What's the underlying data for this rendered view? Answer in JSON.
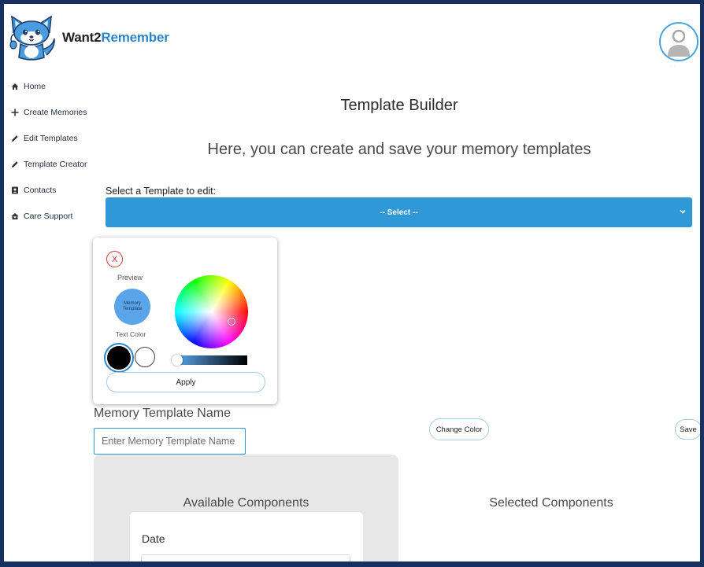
{
  "app": {
    "brand_part1": "Want2",
    "brand_part2": "Remember",
    "avatar_caption": "·· ·"
  },
  "sidebar": {
    "items": [
      {
        "label": "Home",
        "icon": "home-icon"
      },
      {
        "label": "Create Memories",
        "icon": "plus-icon"
      },
      {
        "label": "Edit Templates",
        "icon": "pencil-icon"
      },
      {
        "label": "Template Creator",
        "icon": "pencil-icon"
      },
      {
        "label": "Contacts",
        "icon": "contact-card-icon"
      },
      {
        "label": "Care Support",
        "icon": "home-heart-icon"
      }
    ]
  },
  "main": {
    "title": "Template Builder",
    "subtitle": "Here, you can create and save your memory templates",
    "select_label": "Select a Template to edit:",
    "select_value": "-- Select --",
    "name_label": "Memory Template Name",
    "name_placeholder": "Enter Memory Template Name",
    "change_color_label": "Change Color",
    "save_label": "Save",
    "available_title": "Available Components",
    "selected_title": "Selected Components",
    "components": [
      {
        "name": "Date"
      }
    ]
  },
  "color_picker": {
    "close_label": "X",
    "preview_label": "Preview",
    "preview_text": "Memory Template",
    "text_color_label": "Text Color",
    "apply_label": "Apply",
    "selected_color": "#5aa5ea",
    "text_color_options": [
      "#000000",
      "#ffffff"
    ],
    "selected_text_color": "#000000"
  },
  "colors": {
    "accent": "#2f99d8",
    "frame": "#16305f",
    "close": "#e03131"
  }
}
